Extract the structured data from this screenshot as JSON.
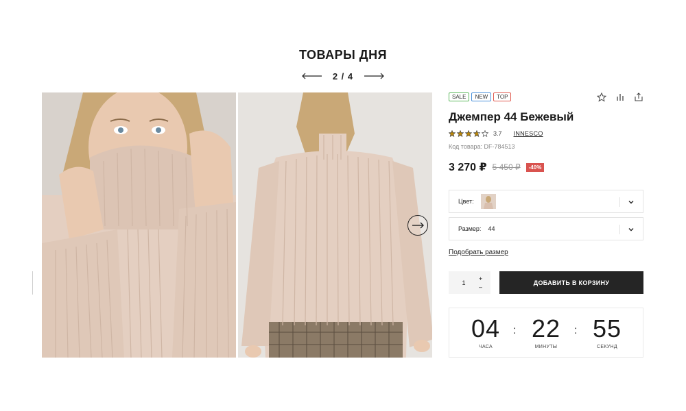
{
  "header": {
    "title": "ТОВАРЫ ДНЯ",
    "page_counter": "2 / 4"
  },
  "product": {
    "badges": [
      "SALE",
      "NEW",
      "TOP"
    ],
    "title": "Джемпер 44 Бежевый",
    "rating": "3.7",
    "rating_stars": 3.7,
    "brand": "INNESCO",
    "sku": "Код товара: DF-784513",
    "price": "3 270 ₽",
    "old_price": "5 450 ₽",
    "discount": "-40%"
  },
  "options": {
    "color_label": "Цвет:",
    "size_label": "Размер:",
    "size_value": "44"
  },
  "fit_link": "Подобрать размер",
  "cart": {
    "quantity": "1",
    "plus": "+",
    "minus": "–",
    "add_label": "ДОБАВИТЬ В КОРЗИНУ"
  },
  "timer": {
    "hours": "04",
    "hours_label": "ЧАСА",
    "minutes": "22",
    "minutes_label": "МИНУТЫ",
    "seconds": "55",
    "seconds_label": "СЕКУНД"
  },
  "icons": {
    "prev": "arrow-left-icon",
    "next": "arrow-right-icon",
    "favorite": "star-icon",
    "compare": "bar-chart-icon",
    "share": "share-icon",
    "chevron": "chevron-down-icon",
    "slider_next": "arrow-circle-right-icon"
  }
}
